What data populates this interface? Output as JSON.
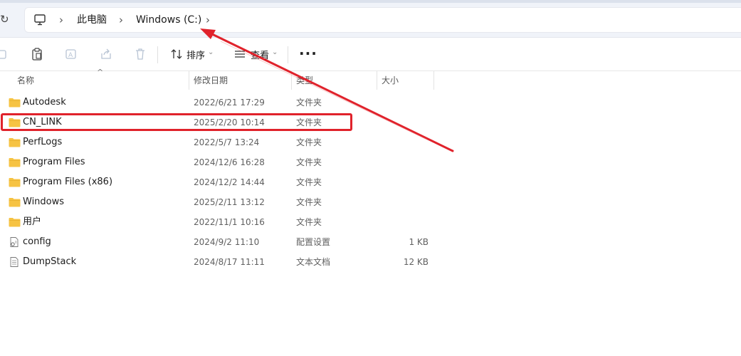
{
  "breadcrumb": {
    "items": [
      {
        "label": "此电脑"
      },
      {
        "label": "Windows (C:)"
      }
    ]
  },
  "toolbar": {
    "sort_label": "排序",
    "view_label": "查看"
  },
  "columns": {
    "name": "名称",
    "date": "修改日期",
    "type": "类型",
    "size": "大小"
  },
  "files": [
    {
      "name": "Autodesk",
      "date": "2022/6/21 17:29",
      "type": "文件夹",
      "size": "",
      "kind": "folder"
    },
    {
      "name": "CN_LINK",
      "date": "2025/2/20 10:14",
      "type": "文件夹",
      "size": "",
      "kind": "folder"
    },
    {
      "name": "PerfLogs",
      "date": "2022/5/7 13:24",
      "type": "文件夹",
      "size": "",
      "kind": "folder"
    },
    {
      "name": "Program Files",
      "date": "2024/12/6 16:28",
      "type": "文件夹",
      "size": "",
      "kind": "folder"
    },
    {
      "name": "Program Files (x86)",
      "date": "2024/12/2 14:44",
      "type": "文件夹",
      "size": "",
      "kind": "folder"
    },
    {
      "name": "Windows",
      "date": "2025/2/11 13:12",
      "type": "文件夹",
      "size": "",
      "kind": "folder"
    },
    {
      "name": "用户",
      "date": "2022/11/1 10:16",
      "type": "文件夹",
      "size": "",
      "kind": "folder"
    },
    {
      "name": "config",
      "date": "2024/9/2 11:10",
      "type": "配置设置",
      "size": "1 KB",
      "kind": "config-file"
    },
    {
      "name": "DumpStack",
      "date": "2024/8/17 11:11",
      "type": "文本文档",
      "size": "12 KB",
      "kind": "text-file"
    }
  ],
  "colors": {
    "folder": "#f6c343",
    "annotation_red": "#e0222b"
  }
}
